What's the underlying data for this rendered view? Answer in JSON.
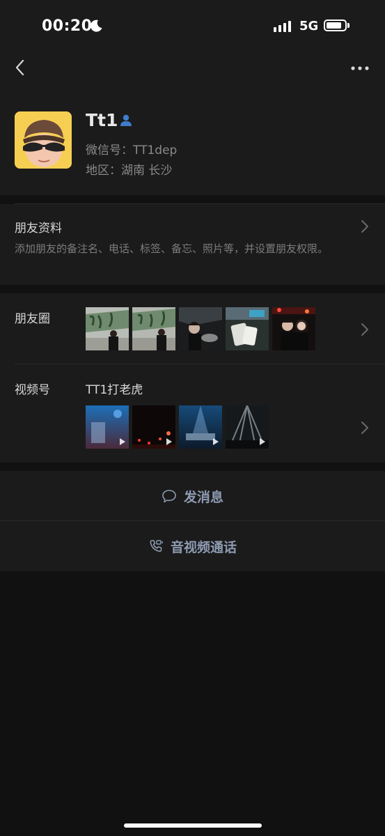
{
  "status": {
    "time": "00:20",
    "network": "5G"
  },
  "profile": {
    "name": "Tt1",
    "wechat_id": "微信号：TT1dep",
    "region": "地区：湖南  长沙"
  },
  "friend_info": {
    "title": "朋友资料",
    "description": "添加朋友的备注名、电话、标签、备忘、照片等，并设置朋友权限。"
  },
  "moments": {
    "label": "朋友圈"
  },
  "channels": {
    "label": "视频号",
    "name": "TT1打老虎"
  },
  "actions": {
    "message": "发消息",
    "call": "音视频通话"
  },
  "icons": [
    "moon-icon",
    "signal-icon",
    "battery-icon",
    "back-icon",
    "more-icon",
    "contact-icon",
    "chevron-right-icon",
    "chat-bubble-icon",
    "phone-video-icon",
    "play-icon"
  ],
  "colors": {
    "background": "#111111",
    "surface": "#1b1b1b",
    "accent_blue": "#3d7dcb",
    "action_text": "#8d9bb2",
    "secondary_text": "#8a8a8a"
  }
}
